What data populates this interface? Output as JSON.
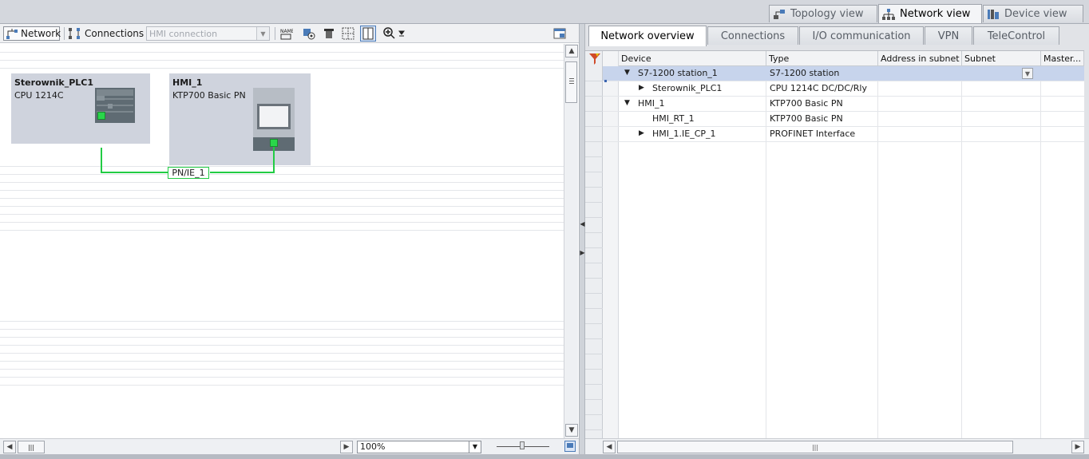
{
  "view_tabs": [
    {
      "label": "Topology view",
      "icon": "topology-icon",
      "active": false
    },
    {
      "label": "Network view",
      "icon": "network-icon",
      "active": true
    },
    {
      "label": "Device view",
      "icon": "device-icon",
      "active": false
    }
  ],
  "toolbar": {
    "network_label": "Network",
    "connections_label": "Connections",
    "hmi_connection_placeholder": "HMI connection",
    "icons": [
      "network-mode-icon",
      "connections-mode-icon",
      "show-names-icon",
      "highlight-icon",
      "device-icon",
      "grid-icon",
      "page-break-icon",
      "zoom-icon",
      "save-layout-icon"
    ]
  },
  "canvas": {
    "devices": [
      {
        "name": "Sterownik_PLC1",
        "type": "CPU 1214C"
      },
      {
        "name": "HMI_1",
        "type": "KTP700 Basic PN"
      }
    ],
    "subnet_label": "PN/IE_1"
  },
  "zoom": {
    "value": "100%"
  },
  "right_panel": {
    "tabs": [
      "Network overview",
      "Connections",
      "I/O communication",
      "VPN",
      "TeleControl"
    ],
    "active_tab": 0,
    "columns": [
      "Device",
      "Type",
      "Address in subnet",
      "Subnet",
      "Master..."
    ],
    "rows": [
      {
        "device": "S7-1200 station_1",
        "type": "S7-1200 station",
        "indent": 1,
        "expander": "open",
        "selected": true
      },
      {
        "device": "Sterownik_PLC1",
        "type": "CPU 1214C DC/DC/Rly",
        "indent": 2,
        "expander": "closed",
        "selected": false
      },
      {
        "device": "HMI_1",
        "type": "KTP700 Basic PN",
        "indent": 1,
        "expander": "open",
        "selected": false
      },
      {
        "device": "HMI_RT_1",
        "type": "KTP700 Basic PN",
        "indent": 2,
        "expander": "none",
        "selected": false
      },
      {
        "device": "HMI_1.IE_CP_1",
        "type": "PROFINET Interface",
        "indent": 2,
        "expander": "closed",
        "selected": false
      }
    ]
  },
  "colors": {
    "device_box": "#cfd3dd",
    "subnet_line": "#22cc44",
    "selected_row": "#c7d4ec",
    "port": "#2ad64a"
  }
}
